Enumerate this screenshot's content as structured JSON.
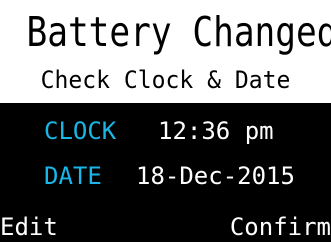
{
  "header": {
    "title": "Battery Changed",
    "subtitle": "Check Clock & Date"
  },
  "rows": {
    "clock": {
      "label": "CLOCK",
      "value": "12:36 pm"
    },
    "date": {
      "label": "DATE",
      "value": "18-Dec-2015"
    }
  },
  "softkeys": {
    "left": "Edit",
    "right": "Confirm"
  },
  "colors": {
    "background": "#000000",
    "header_background": "#ffffff",
    "label": "#19b6e8",
    "value": "#ffffff"
  }
}
